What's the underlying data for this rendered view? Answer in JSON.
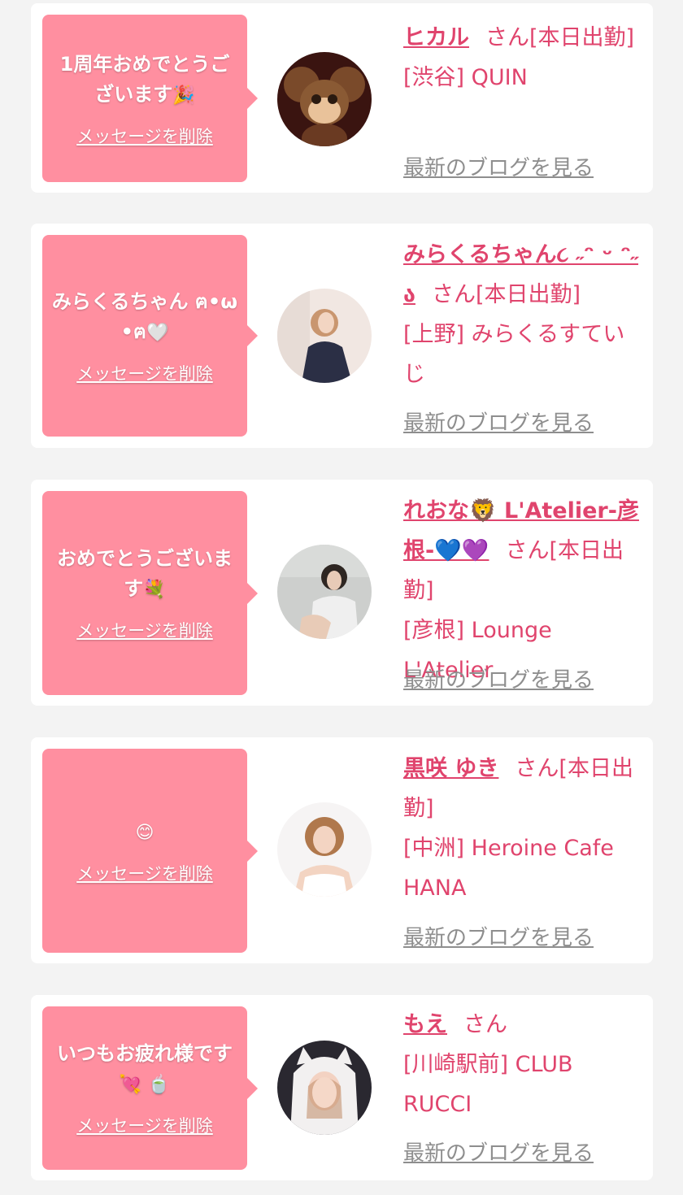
{
  "delete_label": "メッセージを削除",
  "blog_label": "最新のブログを見る",
  "san_label": "さん",
  "colors": {
    "accent": "#e0446d",
    "bubble": "#ff8fa0",
    "card": "#ffffff",
    "bg": "#f3f3f3"
  },
  "cards": [
    {
      "message": "1周年おめでとうございます",
      "message_emoji": "🎉",
      "name": "ヒカル",
      "status": "[本日出勤]",
      "location": "[渋谷] QUIN",
      "avatar": "character-plush-avatar"
    },
    {
      "message": "みらくるちゃん ฅ•ω•ฅ",
      "message_emoji": "🤍",
      "name": "みらくるちゃん૮ ˶ᵔ ᵕ ᵔ˶ ა",
      "status": "[本日出勤]",
      "location": "[上野] みらくるすていじ",
      "avatar": "woman-portrait-avatar"
    },
    {
      "message": "おめでとうございます",
      "message_emoji": "💐",
      "name": "れおな🦁 L'Atelier-彦根-💙💜",
      "status": "[本日出勤]",
      "location": "[彦根] Lounge L'Atelier",
      "avatar": "woman-portrait-avatar"
    },
    {
      "message": "",
      "message_emoji": "😊",
      "name": "黒咲 ゆき",
      "status": "[本日出勤]",
      "location": "[中洲] Heroine Cafe HANA",
      "avatar": "woman-portrait-avatar"
    },
    {
      "message": "いつもお疲れ様です",
      "message_emoji": "💘 🍵",
      "name": "もえ",
      "status": "",
      "location": "[川崎駅前] CLUB RUCCI",
      "avatar": "woman-portrait-avatar"
    }
  ]
}
